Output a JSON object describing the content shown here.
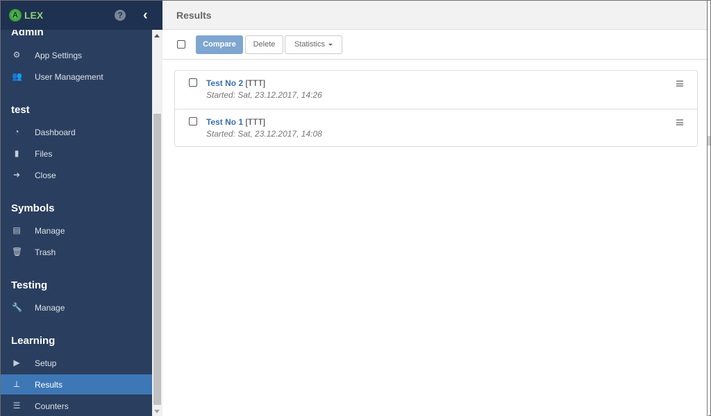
{
  "brand": {
    "logo_letter": "A",
    "name": "LEX"
  },
  "header_icons": {
    "help": "?",
    "collapse": "‹"
  },
  "sidebar": {
    "sections": [
      {
        "title": "Admin",
        "items": [
          {
            "label": "App Settings",
            "icon": "⚙"
          },
          {
            "label": "User Management",
            "icon": "👥"
          }
        ]
      },
      {
        "title": "test",
        "items": [
          {
            "label": "Dashboard",
            "icon": "◔"
          },
          {
            "label": "Files",
            "icon": "▮"
          },
          {
            "label": "Close",
            "icon": "➜"
          }
        ]
      },
      {
        "title": "Symbols",
        "items": [
          {
            "label": "Manage",
            "icon": "▤"
          },
          {
            "label": "Trash",
            "icon": "🗑"
          }
        ]
      },
      {
        "title": "Testing",
        "items": [
          {
            "label": "Manage",
            "icon": "🔧"
          }
        ]
      },
      {
        "title": "Learning",
        "items": [
          {
            "label": "Setup",
            "icon": "▶"
          },
          {
            "label": "Results",
            "icon": "⊥",
            "active": true
          },
          {
            "label": "Counters",
            "icon": "☰"
          }
        ]
      }
    ]
  },
  "page": {
    "title": "Results"
  },
  "toolbar": {
    "compare": "Compare",
    "delete": "Delete",
    "statistics": "Statistics"
  },
  "results": [
    {
      "name": "Test No 2",
      "tag": "[TTT]",
      "started": "Started: Sat, 23.12.2017, 14:26"
    },
    {
      "name": "Test No 1",
      "tag": "[TTT]",
      "started": "Started: Sat, 23.12.2017, 14:08"
    }
  ],
  "colors": {
    "sidebar": "#2a3f5f",
    "brand_bar": "#1f3150",
    "active": "#3e77b6",
    "link": "#3a6fb0",
    "compare": "#7fa6d0"
  }
}
